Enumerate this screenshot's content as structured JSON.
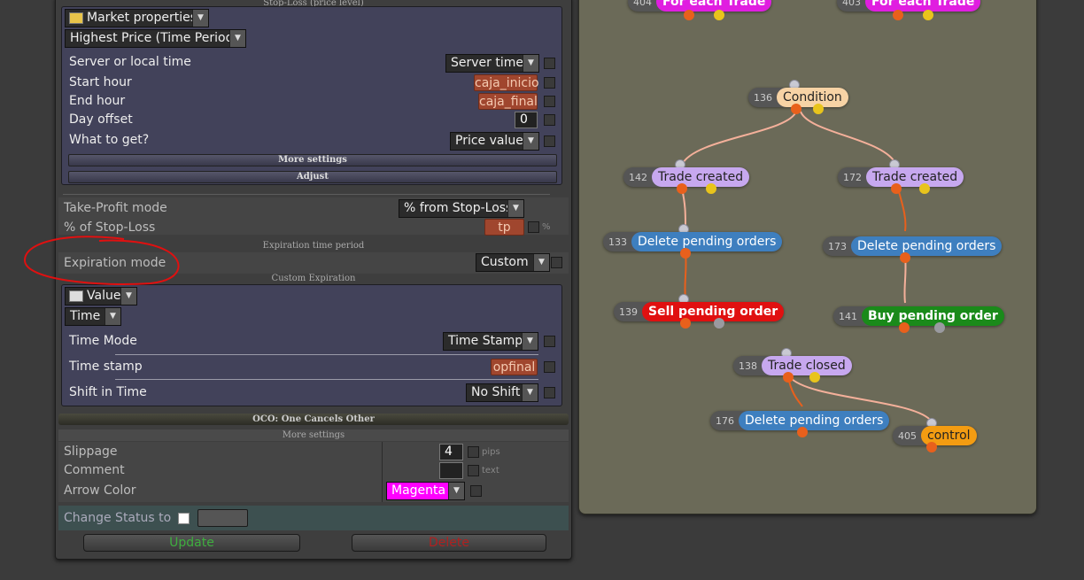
{
  "panel": {
    "header_stoploss": "Stop-Loss (price level)",
    "market_source": "Market properties",
    "market_value": "Highest Price (Time Period)",
    "market_rows": [
      {
        "label": "Server or local time",
        "value": "Server time"
      },
      {
        "label": "Start hour",
        "value": "caja_inicio"
      },
      {
        "label": "End hour",
        "value": "caja_final"
      },
      {
        "label": "Day offset",
        "value": "0"
      },
      {
        "label": "What to get?",
        "value": "Price value"
      }
    ],
    "more_settings_btn": "More settings",
    "adjust_btn": "Adjust",
    "takeprofit": {
      "mode_label": "Take-Profit mode",
      "mode_value": "% from Stop-Loss",
      "pct_label": "% of Stop-Loss",
      "pct_value": "tp",
      "pct_unit": "%"
    },
    "expiration_header": "Expiration time period",
    "expiration_label": "Expiration mode",
    "expiration_value": "Custom",
    "custom_header": "Custom Expiration",
    "custom": {
      "source": "Value",
      "type": "Time",
      "rows": [
        {
          "label": "Time Mode",
          "value": "Time Stamp"
        },
        {
          "label": "Time stamp",
          "value": "opfinal"
        },
        {
          "label": "Shift in Time",
          "value": "No Shift"
        }
      ]
    },
    "oco_header": "OCO: One Cancels Other",
    "more_settings_header": "More settings",
    "extra_rows": [
      {
        "label": "Slippage",
        "value": "4",
        "unit": "pips"
      },
      {
        "label": "Comment",
        "value": "",
        "unit": "text"
      },
      {
        "label": "Arrow Color",
        "value": "Magenta",
        "unit": ""
      }
    ],
    "change_status_label": "Change Status to",
    "update_btn": "Update",
    "delete_btn": "Delete",
    "colors": {
      "update": "#3fae3f",
      "delete": "#b02020",
      "magenta": "#ff00ff",
      "annotation": "#e01010"
    }
  },
  "canvas": {
    "nodes": [
      {
        "id": "404",
        "name": "For each Trade",
        "color": "#e01ee0"
      },
      {
        "id": "403",
        "name": "For each Trade",
        "color": "#e01ee0"
      },
      {
        "id": "136",
        "name": "Condition",
        "color": "#f7d3a5"
      },
      {
        "id": "142",
        "name": "Trade created",
        "color": "#c7a8ef"
      },
      {
        "id": "172",
        "name": "Trade created",
        "color": "#c7a8ef"
      },
      {
        "id": "133",
        "name": "Delete pending orders",
        "color": "#3e7fbf"
      },
      {
        "id": "173",
        "name": "Delete pending orders",
        "color": "#3e7fbf"
      },
      {
        "id": "139",
        "name": "Sell pending order",
        "color": "#e01010"
      },
      {
        "id": "141",
        "name": "Buy pending order",
        "color": "#1a8a1a"
      },
      {
        "id": "138",
        "name": "Trade closed",
        "color": "#c7a8ef"
      },
      {
        "id": "176",
        "name": "Delete pending orders",
        "color": "#3e7fbf"
      },
      {
        "id": "405",
        "name": "control",
        "color": "#f39c12"
      }
    ]
  }
}
